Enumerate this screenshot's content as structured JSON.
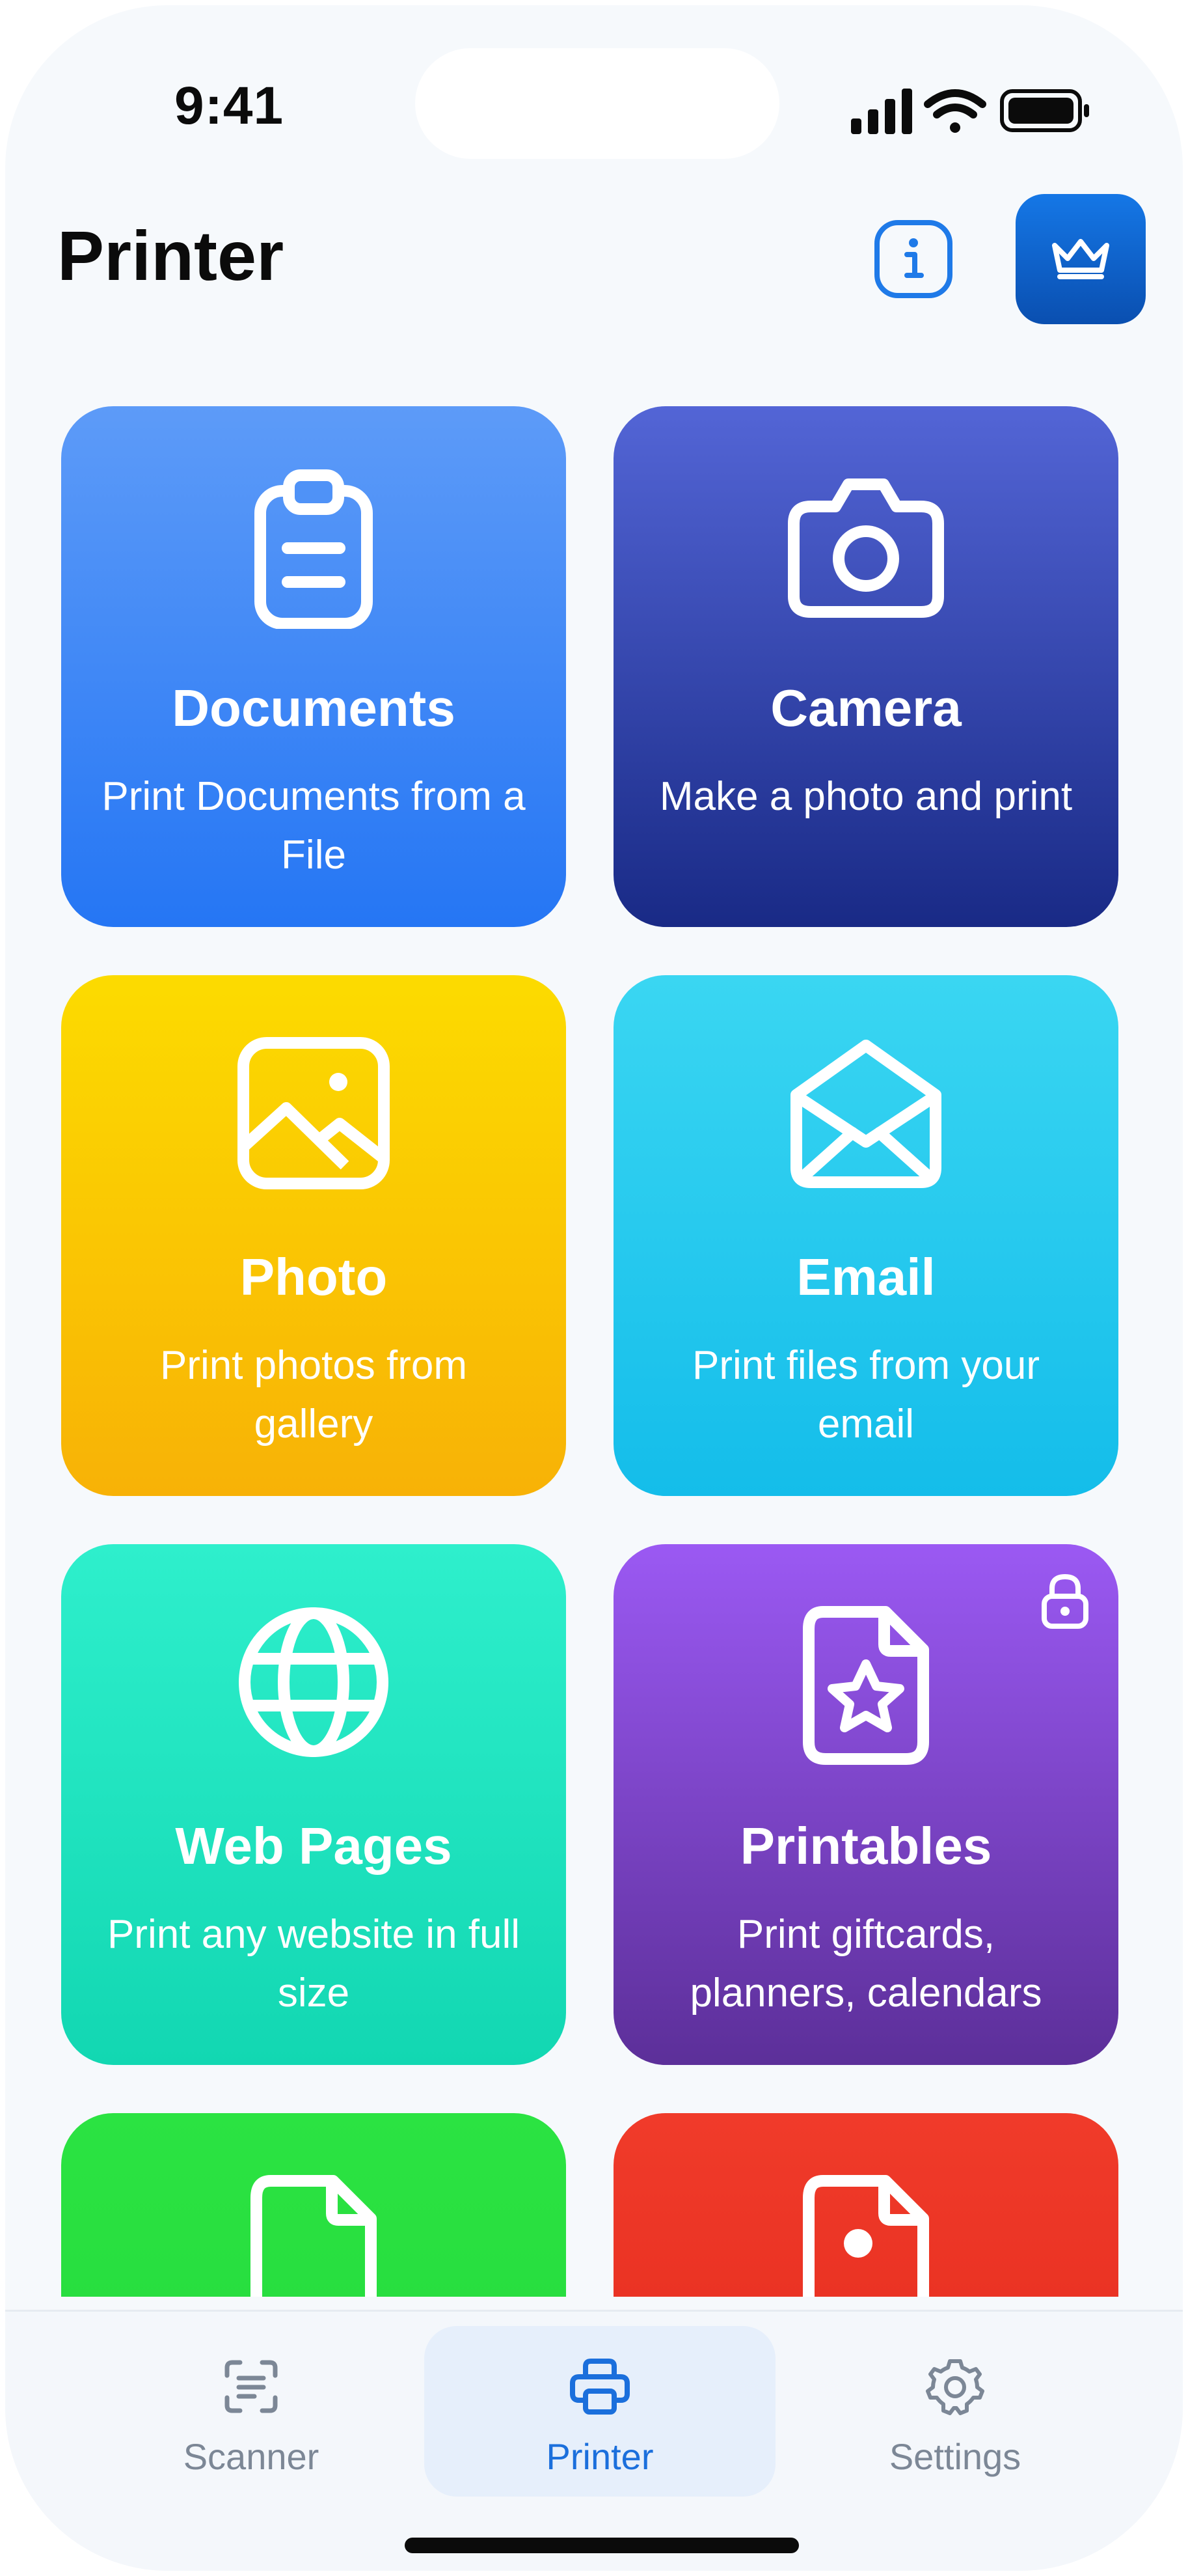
{
  "status_bar": {
    "time": "9:41",
    "icons": [
      "cellular-signal-icon",
      "wifi-icon",
      "battery-icon"
    ]
  },
  "header": {
    "title": "Printer",
    "info_icon": "info-icon",
    "premium_icon": "crown-icon"
  },
  "cards": [
    {
      "id": "documents",
      "title": "Documents",
      "description": "Print Documents from a File",
      "icon": "clipboard-icon",
      "color_top": "#5d9bf8",
      "color_bottom": "#2576f4"
    },
    {
      "id": "camera",
      "title": "Camera",
      "description": "Make a photo and print",
      "icon": "camera-icon",
      "color_top": "#5365d6",
      "color_bottom": "#192a86"
    },
    {
      "id": "photo",
      "title": "Photo",
      "description": "Print photos from gallery",
      "icon": "image-icon",
      "color_top": "#fcdb00",
      "color_bottom": "#f8b206"
    },
    {
      "id": "email",
      "title": "Email",
      "description": "Print files from your email",
      "icon": "open-envelope-icon",
      "color_top": "#3ad6f2",
      "color_bottom": "#14bdea"
    },
    {
      "id": "web-pages",
      "title": "Web Pages",
      "description": "Print any website in full size",
      "icon": "globe-icon",
      "color_top": "#2eefcc",
      "color_bottom": "#12d7b2"
    },
    {
      "id": "printables",
      "title": "Printables",
      "description": "Print giftcards, planners, calendars",
      "icon": "star-document-icon",
      "locked": true,
      "lock_icon": "lock-icon",
      "color_top": "#9b59f3",
      "color_bottom": "#5c2f99"
    },
    {
      "id": "partial-green",
      "icon": "document-icon",
      "color_top": "#2be342",
      "color_bottom": "#22d63a"
    },
    {
      "id": "partial-red",
      "icon": "pdf-document-icon",
      "color_top": "#f03b2a",
      "color_bottom": "#e02418"
    }
  ],
  "tabbar": {
    "tabs": [
      {
        "label": "Scanner",
        "icon": "scanner-icon",
        "selected": false
      },
      {
        "label": "Printer",
        "icon": "printer-icon",
        "selected": true
      },
      {
        "label": "Settings",
        "icon": "gear-icon",
        "selected": false
      }
    ]
  },
  "colors": {
    "accent": "#1b6fdc",
    "background": "#f6f9fc",
    "tab_inactive": "#7c8796"
  }
}
